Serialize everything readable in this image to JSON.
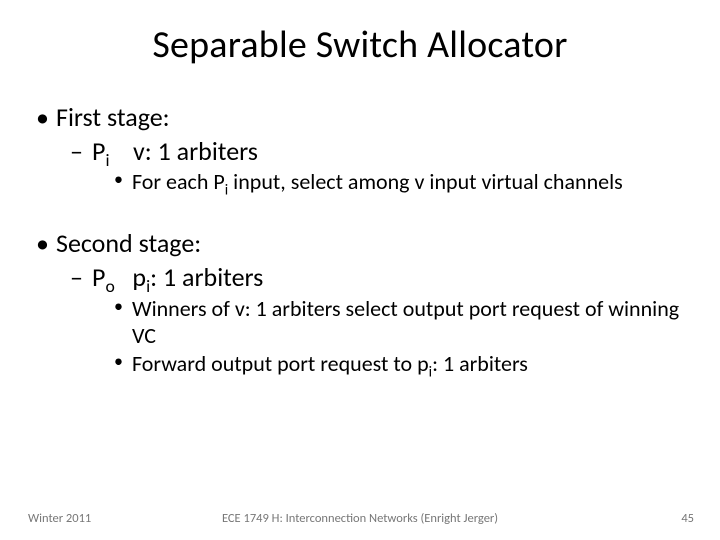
{
  "title": "Separable Switch Allocator",
  "bullets": {
    "first_stage": "First stage:",
    "pi_arbiters_pre": "P",
    "pi_arbiters_sub": "i",
    "pi_arbiters_post": "    v: 1 arbiters",
    "for_each_pre": "For each P",
    "for_each_sub": "i",
    "for_each_post": " input, select among v input virtual channels",
    "second_stage": "Second stage:",
    "po_arbiters_pre": "P",
    "po_arbiters_sub1": "o",
    "po_arbiters_mid": "   p",
    "po_arbiters_sub2": "i",
    "po_arbiters_post": ": 1 arbiters",
    "winners": "Winners of v: 1 arbiters select output port request of winning VC",
    "forward_pre": "Forward output port request to p",
    "forward_sub": "i",
    "forward_post": ": 1 arbiters"
  },
  "footer": {
    "left": "Winter 2011",
    "center": "ECE 1749 H: Interconnection Networks (Enright Jerger)",
    "right": "45"
  }
}
